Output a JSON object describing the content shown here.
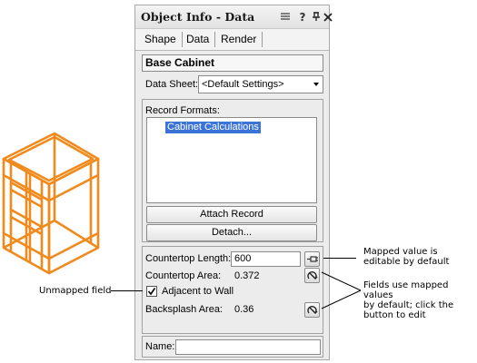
{
  "panel": {
    "title": "Object Info - Data",
    "tabs": [
      "Shape",
      "Data",
      "Render"
    ],
    "object_title": "Base Cabinet",
    "data_sheet": {
      "label": "Data Sheet:",
      "value": "<Default Settings>"
    },
    "record_formats": {
      "label": "Record Formats:",
      "items": [
        "Cabinet Calculations"
      ]
    },
    "attach_button": "Attach Record",
    "detach_button": "Detach...",
    "fields": [
      {
        "label": "Countertop Length:",
        "value": "600"
      },
      {
        "label": "Countertop Area:",
        "value": "0.372"
      },
      {
        "label": "Adjacent to Wall",
        "checked": true
      },
      {
        "label": "Backsplash Area:",
        "value": "0.36"
      }
    ],
    "name_label": "Name:",
    "name_value": ""
  },
  "annotations": {
    "unmapped": "Unmapped field",
    "mapped_editable": [
      "Mapped value is",
      "editable by default"
    ],
    "fields_mapped": [
      "Fields use mapped values",
      "by default; click the",
      "button to edit"
    ]
  },
  "colors": {
    "cabinet": "#f08a1c",
    "selection": "#3b73d6"
  },
  "icons": [
    "menu-icon",
    "help-icon",
    "pin-icon",
    "close-icon",
    "edit-icon",
    "mapped-value-icon",
    "cabinet-graphic"
  ]
}
